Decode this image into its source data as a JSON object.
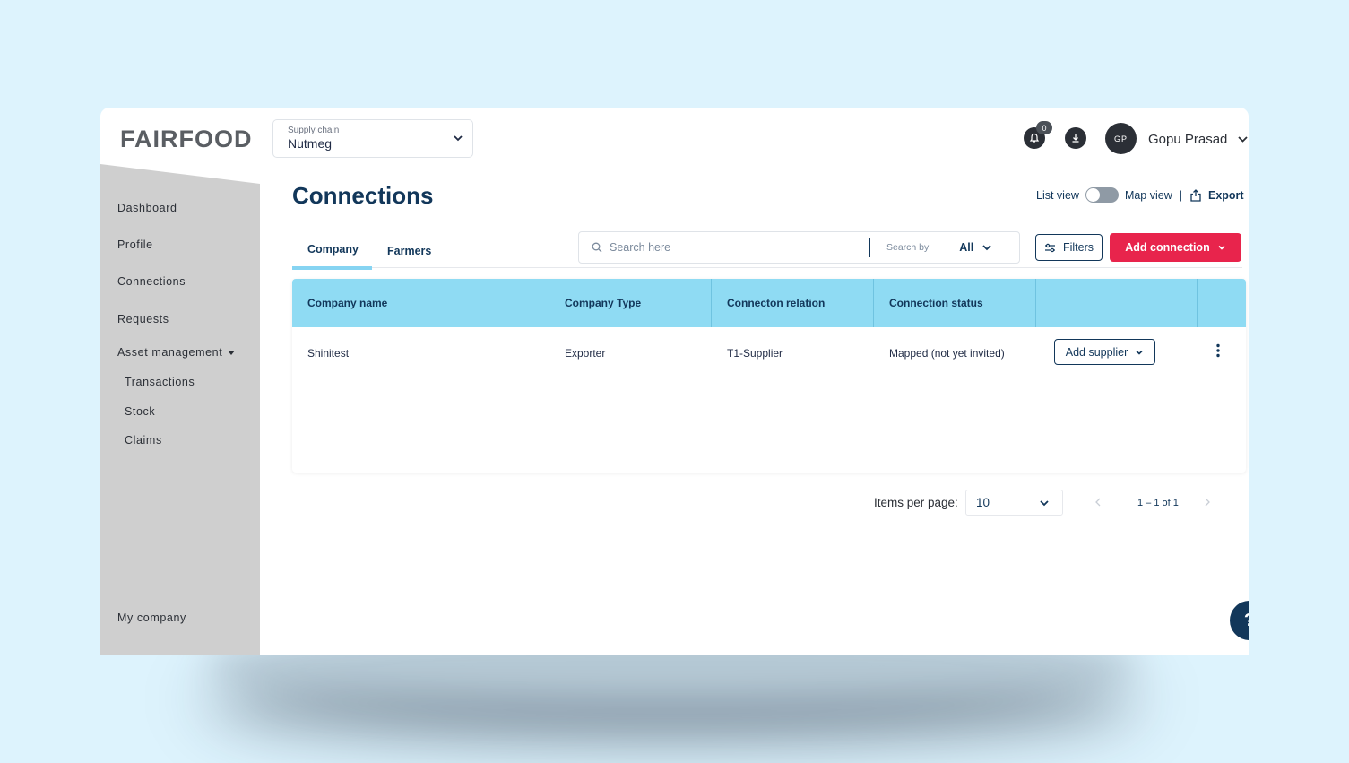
{
  "brand": {
    "logo_text": "FAIRFOOD"
  },
  "supply_chain": {
    "label": "Supply chain",
    "value": "Nutmeg"
  },
  "header": {
    "notification_count": "0",
    "avatar_initials": "GP",
    "user_name": "Gopu Prasad"
  },
  "sidebar": {
    "items": [
      {
        "label": "Dashboard"
      },
      {
        "label": "Profile"
      },
      {
        "label": "Connections"
      },
      {
        "label": "Requests"
      },
      {
        "label": "Asset management"
      },
      {
        "label": "Transactions"
      },
      {
        "label": "Stock"
      },
      {
        "label": "Claims"
      },
      {
        "label": "My company"
      }
    ]
  },
  "page": {
    "title": "Connections",
    "list_view_label": "List view",
    "map_view_label": "Map view",
    "separator": "|",
    "export_label": "Export"
  },
  "tabs": [
    {
      "label": "Company",
      "active": true
    },
    {
      "label": "Farmers",
      "active": false
    }
  ],
  "search": {
    "placeholder": "Search here",
    "search_by_label": "Search by",
    "search_by_value": "All"
  },
  "buttons": {
    "filters": "Filters",
    "add_connection": "Add connection"
  },
  "table": {
    "columns": [
      "Company name",
      "Company Type",
      "Connecton relation",
      "Connection status",
      "",
      ""
    ],
    "rows": [
      {
        "company_name": "Shinitest",
        "company_type": "Exporter",
        "relation": "T1-Supplier",
        "status": "Mapped (not yet invited)",
        "action": "Add supplier"
      }
    ]
  },
  "pagination": {
    "items_per_page_label": "Items per page:",
    "items_per_page": "10",
    "range": "1 – 1 of 1"
  },
  "help": {
    "label": "?"
  },
  "colors": {
    "accent_red": "#e8244c",
    "navy": "#12375a",
    "table_header": "#8fdbf3",
    "sidebar": "#cfcfcf",
    "background": "#ddf3fd"
  }
}
